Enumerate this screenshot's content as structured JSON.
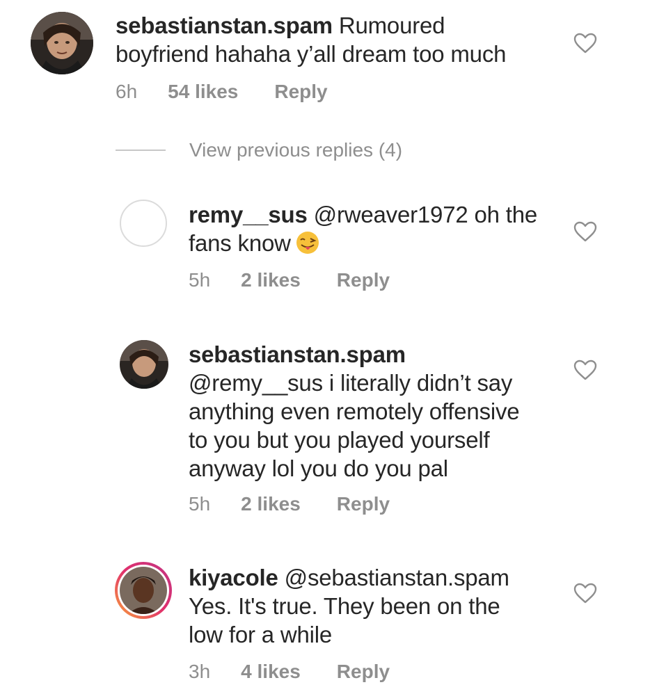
{
  "comments": [
    {
      "username": "sebastianstan.spam",
      "text": " Rumoured",
      "text2": "boyfriend hahaha y’all dream too much",
      "time": "6h",
      "likes": "54 likes",
      "reply": "Reply",
      "avatar_icon": "profile-photo"
    },
    {
      "username": "remy__sus",
      "text": " @rweaver1972 oh the",
      "text2": "fans know",
      "emoji": "winking-tongue-face-emoji",
      "time": "5h",
      "likes": "2 likes",
      "reply": "Reply",
      "avatar_icon": "empty-avatar-circle"
    },
    {
      "username": "sebastianstan.spam",
      "text": "@remy__sus i literally didn’t say",
      "text2": "anything even remotely offensive",
      "text3": "to you but you played yourself",
      "text4": "anyway lol you do you pal",
      "time": "5h",
      "likes": "2 likes",
      "reply": "Reply",
      "avatar_icon": "profile-photo"
    },
    {
      "username": "kiyacole",
      "text": " @sebastianstan.spam",
      "text2": "Yes. It's true. They been on the",
      "text3": "low for a while",
      "time": "3h",
      "likes": "4 likes",
      "reply": "Reply",
      "avatar_icon": "profile-photo-story-ring"
    }
  ],
  "view_previous": "View previous replies (4)",
  "icons": {
    "like": "heart-outline-icon"
  },
  "colors": {
    "text": "#262626",
    "secondary": "#8e8e8e",
    "divider": "#c7c7c7",
    "story_ring": "#e1306c"
  }
}
